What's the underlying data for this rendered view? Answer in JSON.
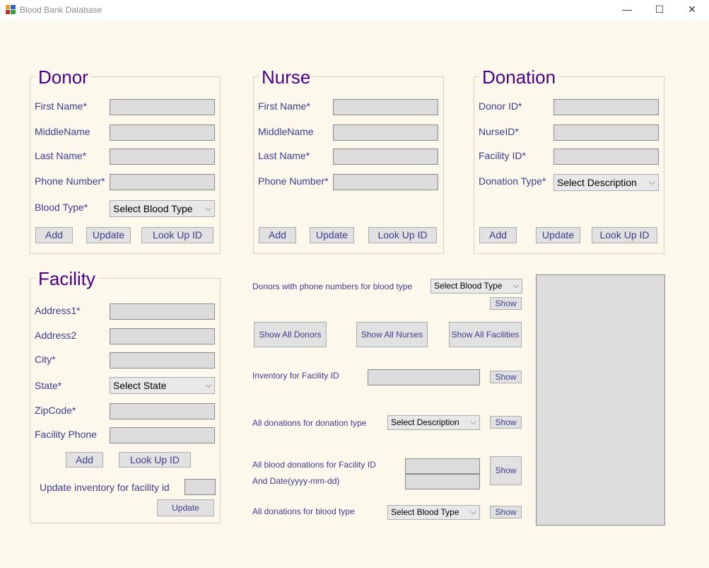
{
  "window": {
    "title": "Blood Bank Database",
    "minimize": "—",
    "maximize": "☐",
    "close": "✕"
  },
  "donor": {
    "legend": "Donor",
    "first_name": "First Name*",
    "middle_name": "MiddleName",
    "last_name": "Last Name*",
    "phone": "Phone Number*",
    "blood_type": "Blood Type*",
    "blood_type_value": "Select Blood Type",
    "add": "Add",
    "update": "Update",
    "lookup": "Look Up ID"
  },
  "nurse": {
    "legend": "Nurse",
    "first_name": "First Name*",
    "middle_name": "MiddleName",
    "last_name": "Last Name*",
    "phone": "Phone Number*",
    "add": "Add",
    "update": "Update",
    "lookup": "Look Up ID"
  },
  "donation": {
    "legend": "Donation",
    "donor_id": "Donor ID*",
    "nurse_id": "NurseID*",
    "facility_id": "Facility ID*",
    "type": "Donation Type*",
    "type_value": "Select Description",
    "add": "Add",
    "update": "Update",
    "lookup": "Look Up ID"
  },
  "facility": {
    "legend": "Facility",
    "address1": "Address1*",
    "address2": "Address2",
    "city": "City*",
    "state": "State*",
    "state_value": "Select State",
    "zipcode": "ZipCode*",
    "phone": "Facility Phone",
    "add": "Add",
    "lookup": "Look Up ID",
    "update_inventory": "Update inventory for facility id",
    "update": "Update"
  },
  "queries": {
    "donors_phone": "Donors with phone numbers for blood type",
    "donors_phone_combo": "Select Blood Type",
    "show": "Show",
    "show_all_donors": "Show All Donors",
    "show_all_nurses": "Show All Nurses",
    "show_all_facilities": "Show All Facilities",
    "inventory": "Inventory for Facility ID",
    "donations_type": "All donations for donation type",
    "donations_type_combo": "Select Description",
    "facility_donations": "All blood donations for Facility ID",
    "facility_date": "And Date(yyyy-mm-dd)",
    "donations_blood": "All donations for blood type",
    "donations_blood_combo": "Select Blood Type"
  },
  "icons": {
    "chevron": "⌵"
  }
}
